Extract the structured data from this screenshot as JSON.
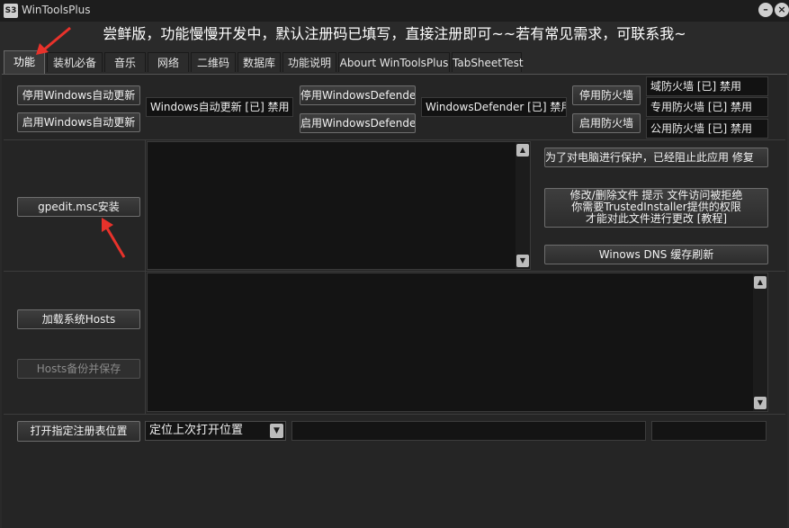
{
  "window": {
    "logo_text": "S3",
    "title": "WinToolsPlus",
    "minimize_glyph": "–",
    "close_glyph": "×"
  },
  "announcement": "尝鲜版，功能慢慢开发中，默认注册码已填写，直接注册即可~~若有常见需求，可联系我~",
  "tabs": [
    {
      "label": "功能",
      "active": true
    },
    {
      "label": "装机必备"
    },
    {
      "label": "音乐"
    },
    {
      "label": "网络"
    },
    {
      "label": "二维码"
    },
    {
      "label": "数据库"
    },
    {
      "label": "功能说明"
    },
    {
      "label": "Abourt WinToolsPlus"
    },
    {
      "label": "TabSheetTest"
    }
  ],
  "updates": {
    "disable_label": "停用Windows自动更新",
    "enable_label": "启用Windows自动更新",
    "status": "Windows自动更新 [已] 禁用"
  },
  "defender": {
    "disable_label": "停用WindowsDefender",
    "enable_label": "启用WindowsDefender",
    "status": "WindowsDefender [已] 禁用"
  },
  "firewall": {
    "disable_label": "停用防火墙",
    "enable_label": "启用防火墙",
    "domain_status": "域防火墙 [已] 禁用",
    "private_status": "专用防火墙 [已] 禁用",
    "public_status": "公用防火墙 [已] 禁用"
  },
  "gpedit": {
    "button_label": "gpedit.msc安装"
  },
  "tools": {
    "protect_fix_label": "为了对电脑进行保护，已经阻止此应用 修复",
    "trusted_line1": "修改/删除文件 提示 文件访问被拒绝",
    "trusted_line2": "你需要TrustedInstaller提供的权限",
    "trusted_line3": "才能对此文件进行更改 [教程]",
    "dns_label": "Winows DNS 缓存刷新"
  },
  "hosts": {
    "load_label": "加载系统Hosts",
    "backup_label": "Hosts备份并保存"
  },
  "registry": {
    "open_label": "打开指定注册表位置",
    "select_value": "定位上次打开位置"
  },
  "icons": {
    "scroll_up": "up-arrow",
    "scroll_down": "down-arrow",
    "dropdown": "chevron-down",
    "annotation": "red-arrow"
  },
  "colors": {
    "annotation_arrow": "#e8322b",
    "background": "#252525",
    "input_background": "#141414"
  }
}
